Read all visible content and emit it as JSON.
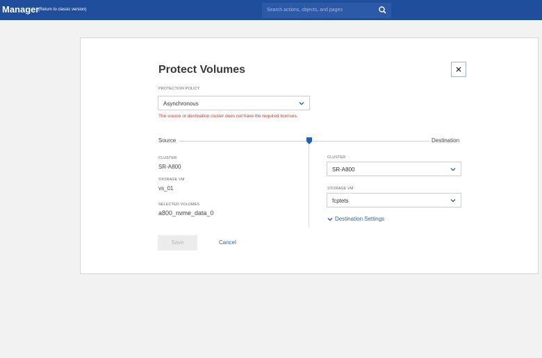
{
  "header": {
    "app_title": "Manager",
    "classic_link": "(Return to classic version)",
    "search_placeholder": "Search actions, objects, and pages"
  },
  "dialog": {
    "title": "Protect Volumes",
    "protection_policy": {
      "label": "PROTECTION POLICY",
      "value": "Asynchronous"
    },
    "error": "The source or destination cluster does not have the required licenses.",
    "source_label": "Source",
    "destination_label": "Destination",
    "source": {
      "cluster_label": "CLUSTER",
      "cluster": "SR-A800",
      "storage_vm_label": "STORAGE VM",
      "storage_vm": "vs_01",
      "volumes_label": "SELECTED VOLUMES",
      "volumes": "a800_nvme_data_0"
    },
    "destination": {
      "cluster_label": "CLUSTER",
      "cluster": "SR-A800",
      "storage_vm_label": "STORAGE VM",
      "storage_vm": "fcptets",
      "settings_link": "Destination Settings"
    },
    "save_label": "Save",
    "cancel_label": "Cancel"
  },
  "colors": {
    "header_bg": "#1f4e9c",
    "accent": "#2a64b4",
    "error": "#c0392b"
  }
}
